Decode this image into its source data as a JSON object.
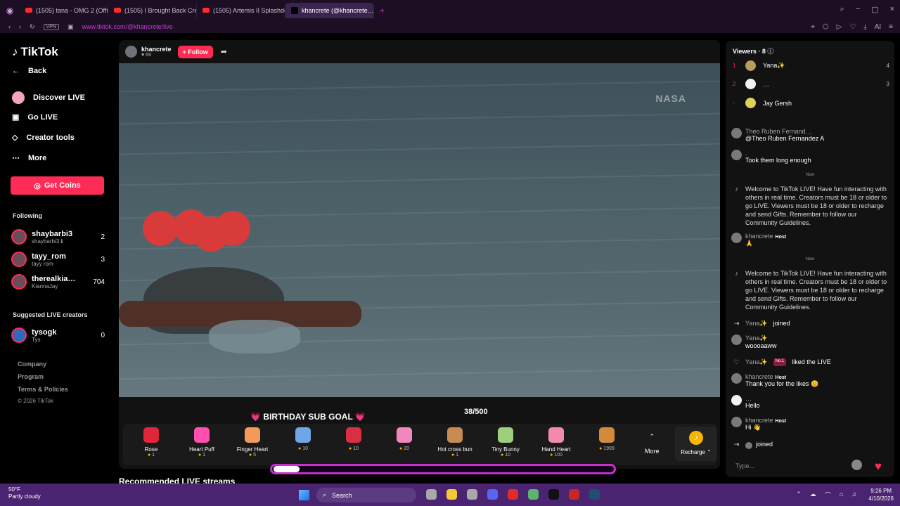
{
  "browser": {
    "tabs": [
      {
        "label": "(1505) tana - OMG 2 (Offi…",
        "type": "youtube"
      },
      {
        "label": "(1505) I Brought Back Cre…",
        "type": "youtube"
      },
      {
        "label": "(1505) Artemis II Splashdo…",
        "type": "youtube"
      },
      {
        "label": "khancrete (@khancrete…",
        "type": "tiktok",
        "active": true
      }
    ],
    "add_tab": "+",
    "vpn": "VPN",
    "url": "www.tiktok.com/@khancrete/live",
    "ai_label": "AI"
  },
  "sidebar": {
    "logo": "TikTok",
    "nav": [
      {
        "label": "Back",
        "icon": "back-arrow-icon"
      },
      {
        "label": "Discover LIVE",
        "icon": "discover-live-icon"
      },
      {
        "label": "Go LIVE",
        "icon": "camera-icon"
      },
      {
        "label": "Creator tools",
        "icon": "lightbulb-icon"
      },
      {
        "label": "More",
        "icon": "more-dots-icon"
      }
    ],
    "get_coins": "Get Coins",
    "following_title": "Following",
    "following": [
      {
        "name": "shaybarbi3",
        "sub": "shaybarbi3 ℹ",
        "count": "2"
      },
      {
        "name": "tayy_rom",
        "sub": "tayy rom",
        "count": "3"
      },
      {
        "name": "therealkia…",
        "sub": "KiannaJay",
        "count": "704"
      }
    ],
    "suggested_title": "Suggested LIVE creators",
    "suggested": [
      {
        "name": "tysogk",
        "sub": "Tys",
        "count": "0"
      }
    ],
    "footer": [
      "Company",
      "Program",
      "Terms & Policies",
      "© 2026 TikTok"
    ]
  },
  "stream": {
    "host": "khancrete",
    "likes": "69",
    "follow": "+ Follow",
    "watermark": "NASA",
    "gifts": [
      {
        "name": "Rose",
        "cost": "1",
        "color": "#e1253b"
      },
      {
        "name": "Heart Puff",
        "cost": "1",
        "color": "#ff4fb0"
      },
      {
        "name": "Finger Heart",
        "cost": "5",
        "color": "#f39a59"
      },
      {
        "name": "",
        "cost": "10",
        "color": "#6fa6e8"
      },
      {
        "name": "",
        "cost": "10",
        "color": "#d92f45"
      },
      {
        "name": "",
        "cost": "20",
        "color": "#f087bd"
      },
      {
        "name": "Hot cross bun",
        "cost": "1",
        "color": "#c98b52"
      },
      {
        "name": "Tiny Bunny",
        "cost": "10",
        "color": "#9ed07c"
      },
      {
        "name": "Hand Heart",
        "cost": "100",
        "color": "#f28ab0"
      },
      {
        "name": "",
        "cost": "1999",
        "color": "#d48a3b"
      }
    ],
    "more": "More",
    "recharge": "Recharge",
    "goal": "BIRTHDAY SUB GOAL",
    "goal_count": "38/500",
    "goal_progress": 0.076,
    "recommended": "Recommended LIVE streams"
  },
  "chat": {
    "viewers_title": "Viewers · 8",
    "viewers": [
      {
        "rank": "1",
        "name": "Yana✨",
        "count": "4"
      },
      {
        "rank": "2",
        "name": "…",
        "count": "3"
      },
      {
        "rank": "-",
        "name": "Jay Gersh",
        "count": ""
      }
    ],
    "messages": [
      {
        "name": "Theo Ruben Fernand…",
        "text": "@Theo Ruben Fernandez A"
      },
      {
        "name": ".",
        "text": "Took them long enough"
      }
    ],
    "now": "Now",
    "system_message": "Welcome to TikTok LIVE! Have fun interacting with others in real time. Creators must be 18 or older to go LIVE. Viewers must be 18 or older to recharge and send Gifts. Remember to follow our Community Guidelines.",
    "host_name": "khancrete",
    "host_tag": "Host",
    "host_emoji": "🙏",
    "events": {
      "joined": "joined",
      "liked": "liked the LIVE",
      "badge": "No.1",
      "yana": "Yana✨",
      "yana_msg": "woooaaww",
      "thank": "Thank you for the likes 😊",
      "dots": "…",
      "hello": "Hello",
      "hi": "Hi 👋",
      "last_join": "joined"
    },
    "input_placeholder": "Type..."
  },
  "taskbar": {
    "temp": "50°F",
    "condition": "Partly cloudy",
    "search": "Search",
    "time": "9:26 PM",
    "date": "4/10/2026"
  }
}
